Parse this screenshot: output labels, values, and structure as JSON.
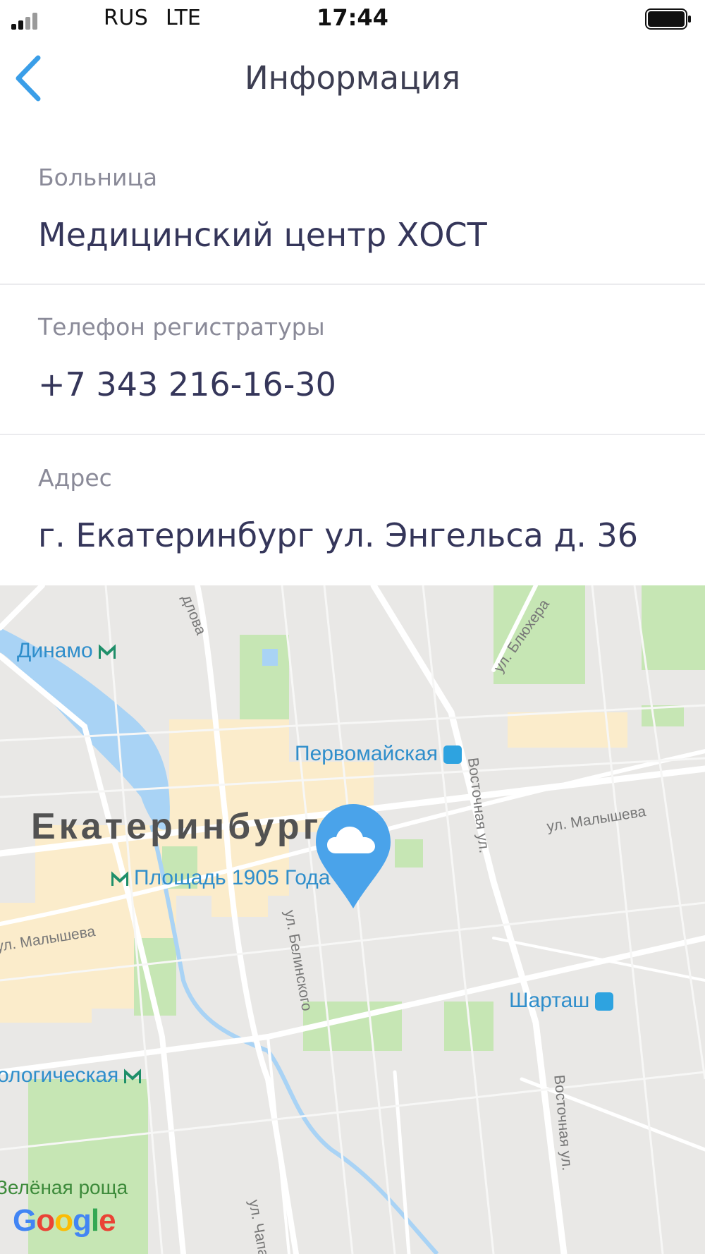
{
  "status_bar": {
    "carrier": "RUS",
    "network": "LTE",
    "time": "17:44"
  },
  "nav": {
    "title": "Информация",
    "back_icon": "chevron-left-icon",
    "accent_color": "#3a9ee8"
  },
  "info": {
    "hospital_label": "Больница",
    "hospital_value": "Медицинский центр ХОСТ",
    "phone_label": "Телефон регистратуры",
    "phone_value": "+7 343 216-16-30",
    "address_label": "Адрес",
    "address_value": "г. Екатеринбург ул. Энгельса д. 36"
  },
  "map": {
    "city": "Екатеринбург",
    "metro_stations": [
      "Динамо",
      "Площадь 1905 Года",
      "ологическая"
    ],
    "rail_stations": [
      "Первомайская",
      "Шарташ"
    ],
    "streets": [
      "ул. Блюхера",
      "ул. Малышева",
      "ул. Малышева",
      "Восточная ул.",
      "Восточная ул.",
      "ул. Белинского",
      "ул. Чапа",
      "длова"
    ],
    "districts": [
      "Зелёная роща"
    ],
    "attribution": "Google",
    "marker_icon": "cloud-icon",
    "marker_color": "#4aa3ea",
    "water_color": "#a9d3f5",
    "park_color": "#c6e6b4",
    "built_up_color": "#fbeccb"
  }
}
